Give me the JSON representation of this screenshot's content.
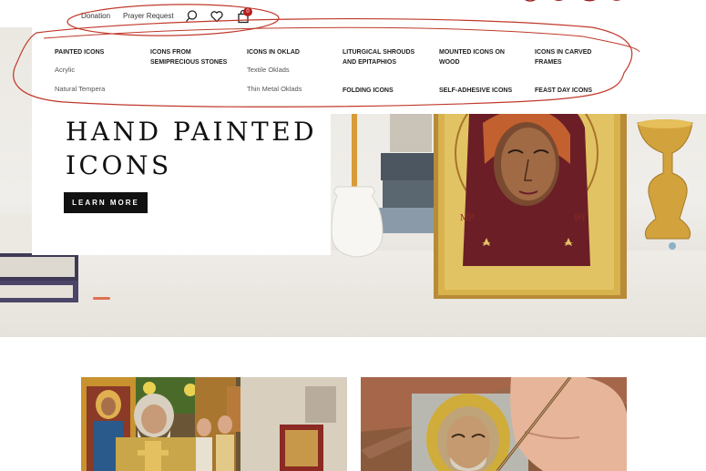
{
  "topbar": {
    "donation": "Donation",
    "prayer_request": "Prayer Request",
    "cart_count": "0"
  },
  "icons": {
    "search": "search-icon",
    "wishlist": "heart-icon",
    "cart": "bag-icon"
  },
  "mega_menu": {
    "col1": {
      "title": "PAINTED ICONS",
      "subs": [
        "Acrylic",
        "Natural Tempera"
      ]
    },
    "col2": {
      "title": "ICONS FROM SEMIPRECIOUS STONES"
    },
    "col3": {
      "title": "ICONS IN OKLAD",
      "subs": [
        "Textile Oklads",
        "Thin Metal Oklads"
      ]
    },
    "col4": {
      "title": "LITURGICAL SHROUDS AND EPITAPHIOS",
      "title2": "FOLDING ICONS"
    },
    "col5": {
      "title": "MOUNTED ICONS ON WOOD",
      "title2": "SELF-ADHESIVE ICONS"
    },
    "col6": {
      "title": "ICONS IN CARVED FRAMES",
      "title2": "FEAST DAY ICONS"
    }
  },
  "hero": {
    "title": "HAND PAINTED ICONS",
    "cta": "LEARN MORE"
  },
  "colors": {
    "annotation": "#c0392b",
    "accent": "#b51f1f",
    "button": "#111111"
  }
}
